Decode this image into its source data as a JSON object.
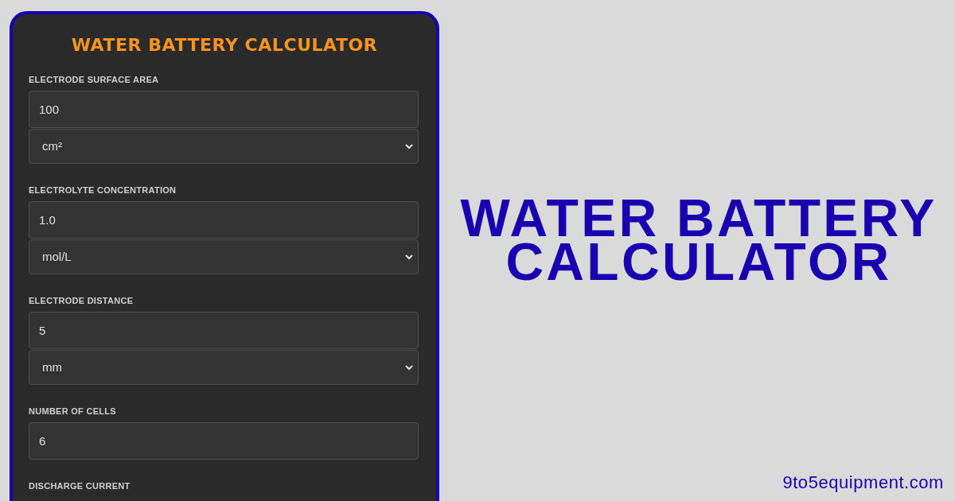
{
  "calculator": {
    "title": "WATER BATTERY CALCULATOR",
    "fields": [
      {
        "label": "ELECTRODE SURFACE AREA",
        "controls": [
          {
            "kind": "input",
            "value": "100"
          },
          {
            "kind": "select",
            "value": "cm²"
          }
        ]
      },
      {
        "label": "ELECTROLYTE CONCENTRATION",
        "controls": [
          {
            "kind": "input",
            "value": "1.0"
          },
          {
            "kind": "select",
            "value": "mol/L"
          }
        ]
      },
      {
        "label": "ELECTRODE DISTANCE",
        "controls": [
          {
            "kind": "input",
            "value": "5"
          },
          {
            "kind": "select",
            "value": "mm"
          }
        ]
      },
      {
        "label": "NUMBER OF CELLS",
        "controls": [
          {
            "kind": "input",
            "value": "6"
          }
        ]
      },
      {
        "label": "DISCHARGE CURRENT"
      }
    ]
  },
  "headline": [
    "WATER BATTERY",
    "CALCULATOR"
  ],
  "website": "9to5equipment.com"
}
